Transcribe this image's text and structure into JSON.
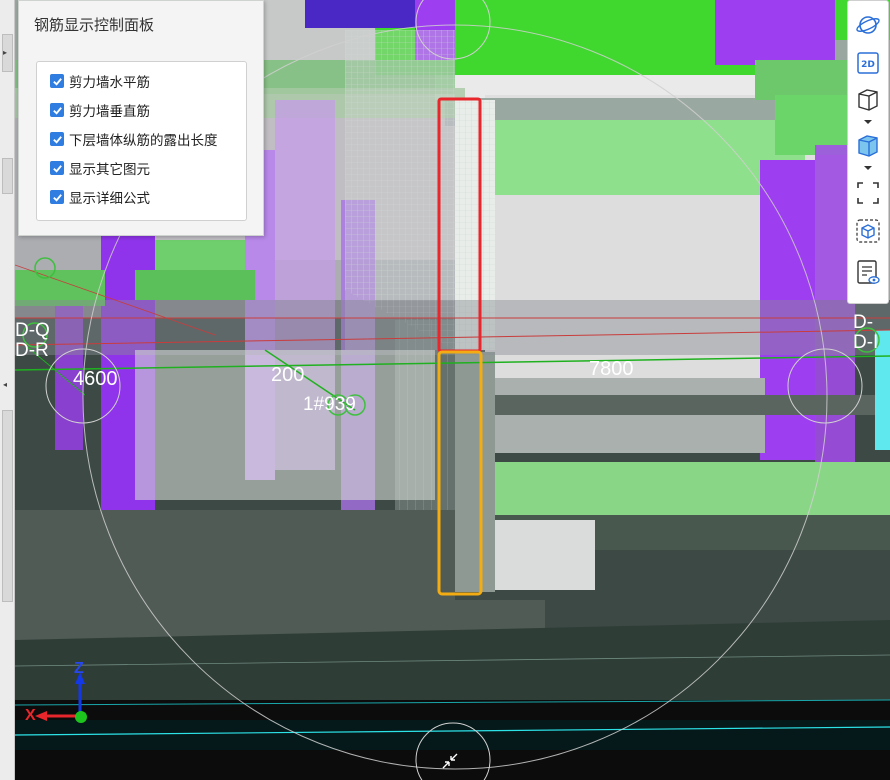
{
  "panel": {
    "title": "钢筋显示控制面板",
    "options": [
      {
        "label": "剪力墙水平筋",
        "checked": true
      },
      {
        "label": "剪力墙垂直筋",
        "checked": true
      },
      {
        "label": "下层墙体纵筋的露出长度",
        "checked": true
      },
      {
        "label": "显示其它图元",
        "checked": true
      },
      {
        "label": "显示详细公式",
        "checked": true
      }
    ]
  },
  "toolbar": {
    "buttons": [
      {
        "name": "orbit-icon"
      },
      {
        "name": "2d-view-icon",
        "text": "2D"
      },
      {
        "name": "3d-box-wire-icon"
      },
      {
        "name": "3d-box-solid-icon"
      },
      {
        "name": "full-screen-icon"
      },
      {
        "name": "cube-select-icon"
      },
      {
        "name": "display-settings-icon"
      }
    ]
  },
  "dimensions": {
    "left": "4600",
    "middle": "200",
    "right": "7800",
    "label_near_wall": "1#939"
  },
  "axis_tags": {
    "left_top": "D-Q",
    "left_bottom": "D-R",
    "right_top": "D-",
    "right_bottom": "D-I"
  },
  "gizmo": {
    "z": "Z",
    "x": "X"
  },
  "colors": {
    "highlight_red": "#e8262b",
    "highlight_orange": "#f3ad12",
    "beam_green": "#7ed57c",
    "column_purple": "#9b3ef0",
    "checkbox_blue": "#2f7de1"
  }
}
